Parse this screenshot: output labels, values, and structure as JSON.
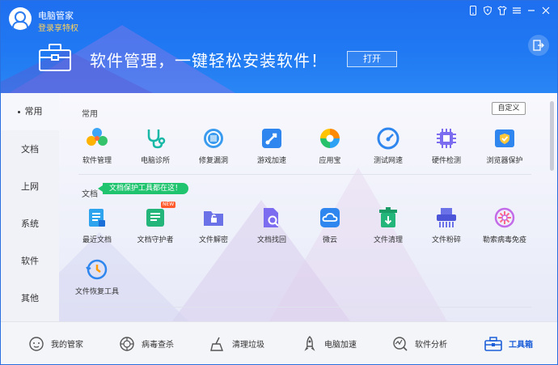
{
  "app": {
    "name": "电脑管家",
    "login": "登录享特权"
  },
  "header": {
    "banner": "软件管理，一键轻松安装软件！",
    "open_label": "打开"
  },
  "sidebar": {
    "items": [
      {
        "label": "常用",
        "active": true
      },
      {
        "label": "文档"
      },
      {
        "label": "上网"
      },
      {
        "label": "系统"
      },
      {
        "label": "软件"
      },
      {
        "label": "其他"
      }
    ]
  },
  "sections": {
    "common": {
      "title": "常用",
      "custom_label": "自定义",
      "tools": [
        {
          "label": "软件管理",
          "icon": "software-manager-icon"
        },
        {
          "label": "电脑诊所",
          "icon": "stethoscope-icon"
        },
        {
          "label": "修复漏洞",
          "icon": "patch-fix-icon"
        },
        {
          "label": "游戏加速",
          "icon": "game-boost-icon"
        },
        {
          "label": "应用宝",
          "icon": "app-store-icon"
        },
        {
          "label": "测试网速",
          "icon": "speedometer-icon"
        },
        {
          "label": "硬件检测",
          "icon": "chip-icon"
        },
        {
          "label": "浏览器保护",
          "icon": "browser-shield-icon"
        }
      ]
    },
    "docs": {
      "title": "文档",
      "tip": "文档保护工具都在这！",
      "new_badge": "NEW",
      "tools": [
        {
          "label": "最近文档",
          "icon": "recent-docs-icon"
        },
        {
          "label": "文档守护者",
          "icon": "doc-guardian-icon"
        },
        {
          "label": "文件解密",
          "icon": "folder-unlock-icon"
        },
        {
          "label": "文档找回",
          "icon": "doc-search-icon"
        },
        {
          "label": "微云",
          "icon": "cloud-icon"
        },
        {
          "label": "文件清理",
          "icon": "trash-icon"
        },
        {
          "label": "文件粉碎",
          "icon": "shredder-icon"
        },
        {
          "label": "勒索病毒免疫",
          "icon": "virus-immune-icon"
        },
        {
          "label": "文件恢复工具",
          "icon": "file-restore-icon"
        }
      ]
    }
  },
  "bottom_nav": [
    {
      "label": "我的管家",
      "icon": "guard-face-icon"
    },
    {
      "label": "病毒查杀",
      "icon": "virus-scan-icon"
    },
    {
      "label": "清理垃圾",
      "icon": "broom-icon"
    },
    {
      "label": "电脑加速",
      "icon": "rocket-icon"
    },
    {
      "label": "软件分析",
      "icon": "analysis-icon"
    },
    {
      "label": "工具箱",
      "icon": "toolbox-icon",
      "active": true
    }
  ],
  "colors": {
    "header": "#1f6ff0",
    "accent": "#1b5ed8",
    "tip_green": "#20c46e"
  }
}
